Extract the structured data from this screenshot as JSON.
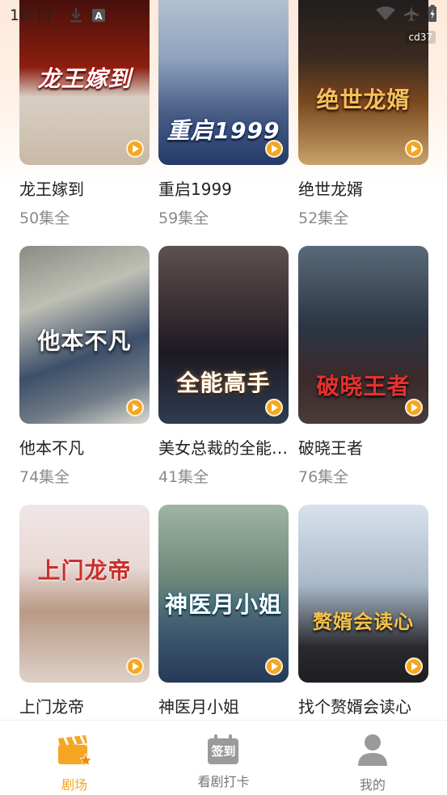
{
  "status_bar": {
    "time": "10:17",
    "tag": "cd37"
  },
  "shows": [
    {
      "title": "龙王嫁到",
      "episodes": "50集全",
      "poster_text": "龙王嫁到"
    },
    {
      "title": "重启1999",
      "episodes": "59集全",
      "poster_text": "重启1999"
    },
    {
      "title": "绝世龙婿",
      "episodes": "52集全",
      "poster_text": "绝世龙婿"
    },
    {
      "title": "他本不凡",
      "episodes": "74集全",
      "poster_text": "他本不凡"
    },
    {
      "title": "美女总裁的全能高手",
      "episodes": "41集全",
      "poster_text": "全能高手"
    },
    {
      "title": "破晓王者",
      "episodes": "76集全",
      "poster_text": "破晓王者"
    },
    {
      "title": "上门龙帝",
      "episodes": "",
      "poster_text": "上门龙帝"
    },
    {
      "title": "神医月小姐",
      "episodes": "",
      "poster_text": "神医月小姐"
    },
    {
      "title": "找个赘婿会读心",
      "episodes": "",
      "poster_text": "赘婿会读心"
    }
  ],
  "bottom_nav": {
    "theater": "剧场",
    "checkin": "看剧打卡",
    "checkin_badge": "签到",
    "profile": "我的"
  },
  "colors": {
    "accent": "#f5a623",
    "inactive": "#777777"
  }
}
